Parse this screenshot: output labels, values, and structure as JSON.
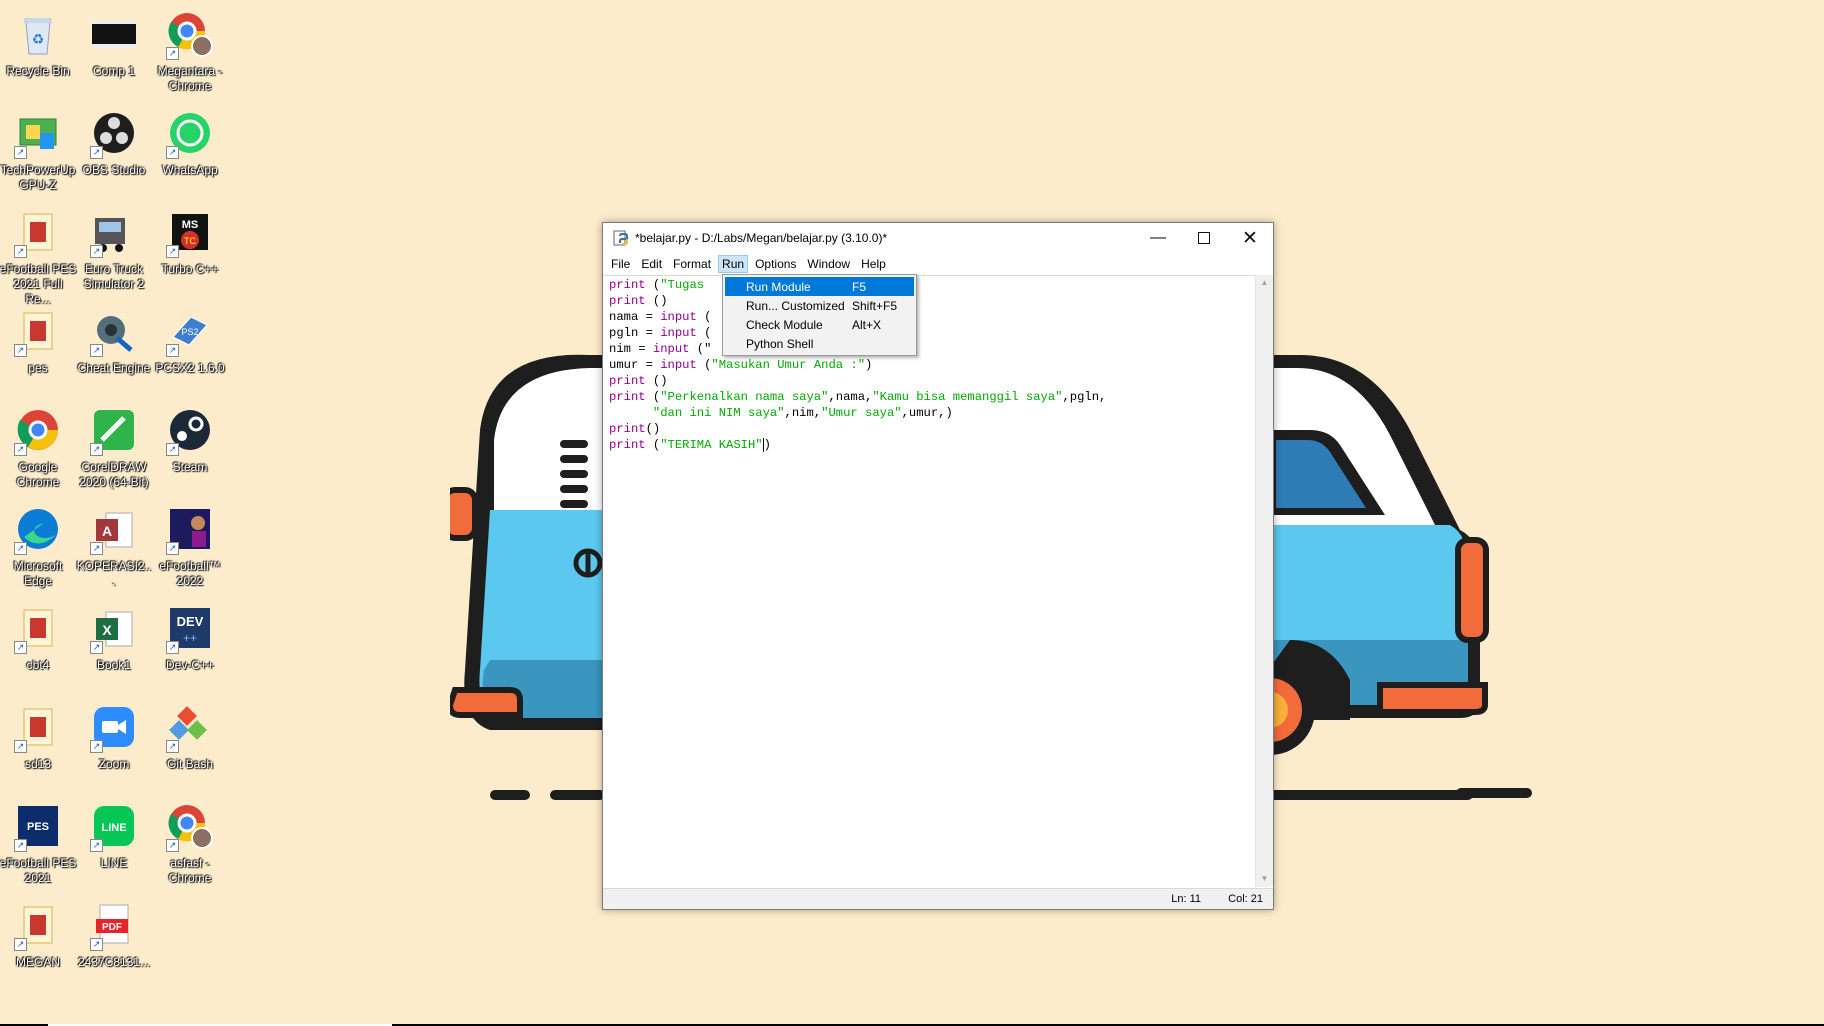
{
  "desktop": {
    "icons": [
      {
        "label": "Recycle Bin",
        "icon": "recycle-bin-icon"
      },
      {
        "label": "Comp 1",
        "icon": "video-file-icon"
      },
      {
        "label": "Megantara - Chrome",
        "icon": "chrome-profile-icon"
      },
      {
        "label": "TechPowerUp GPU-Z",
        "icon": "gpu-z-icon"
      },
      {
        "label": "OBS Studio",
        "icon": "obs-icon"
      },
      {
        "label": "WhatsApp",
        "icon": "whatsapp-icon"
      },
      {
        "label": "eFootball PES 2021 Full Re...",
        "icon": "folder-icon"
      },
      {
        "label": "Euro Truck Simulator 2",
        "icon": "truck-icon"
      },
      {
        "label": "Turbo C++",
        "icon": "turbo-cpp-icon"
      },
      {
        "label": "pes",
        "icon": "folder-icon"
      },
      {
        "label": "Cheat Engine",
        "icon": "cheat-engine-icon"
      },
      {
        "label": "PCSX2 1.6.0",
        "icon": "pcsx2-icon"
      },
      {
        "label": "Google Chrome",
        "icon": "chrome-icon"
      },
      {
        "label": "CorelDRAW 2020 (64-Bit)",
        "icon": "coreldraw-icon"
      },
      {
        "label": "Steam",
        "icon": "steam-icon"
      },
      {
        "label": "Microsoft Edge",
        "icon": "edge-icon"
      },
      {
        "label": "KOPERASI2...",
        "icon": "access-icon"
      },
      {
        "label": "eFootball™ 2022",
        "icon": "efootball-icon"
      },
      {
        "label": "cbt4",
        "icon": "folder-icon"
      },
      {
        "label": "Book1",
        "icon": "excel-icon"
      },
      {
        "label": "Dev-C++",
        "icon": "devcpp-icon"
      },
      {
        "label": "sd13",
        "icon": "folder-icon"
      },
      {
        "label": "Zoom",
        "icon": "zoom-icon"
      },
      {
        "label": "Git Bash",
        "icon": "git-bash-icon"
      },
      {
        "label": "eFootball PES 2021",
        "icon": "pes-icon"
      },
      {
        "label": "LINE",
        "icon": "line-icon"
      },
      {
        "label": "asfasf - Chrome",
        "icon": "chrome-profile-icon"
      },
      {
        "label": "MEGAN",
        "icon": "folder-icon"
      },
      {
        "label": "2437C8131...",
        "icon": "pdf-icon"
      }
    ]
  },
  "window": {
    "title": "*belajar.py - D:/Labs/Megan/belajar.py (3.10.0)*",
    "menus": [
      "File",
      "Edit",
      "Format",
      "Run",
      "Options",
      "Window",
      "Help"
    ],
    "active_menu": "Run"
  },
  "run_menu": {
    "items": [
      {
        "label": "Run Module",
        "accel": "F5",
        "highlighted": true
      },
      {
        "label": "Run... Customized",
        "accel": "Shift+F5",
        "highlighted": false
      },
      {
        "label": "Check Module",
        "accel": "Alt+X",
        "highlighted": false
      },
      {
        "label": "Python Shell",
        "accel": "",
        "highlighted": false
      }
    ]
  },
  "editor": {
    "lines": [
      [
        {
          "t": "print",
          "c": "kw"
        },
        {
          "t": " (",
          "c": "blk"
        },
        {
          "t": "\"Tugas ",
          "c": "str"
        }
      ],
      [
        {
          "t": "print",
          "c": "kw"
        },
        {
          "t": " ()",
          "c": "blk"
        }
      ],
      [
        {
          "t": "nama = ",
          "c": "blk"
        },
        {
          "t": "input",
          "c": "kw"
        },
        {
          "t": " (",
          "c": "blk"
        }
      ],
      [
        {
          "t": "pgln = ",
          "c": "blk"
        },
        {
          "t": "input",
          "c": "kw"
        },
        {
          "t": " (",
          "c": "blk"
        }
      ],
      [
        {
          "t": "nim = ",
          "c": "blk"
        },
        {
          "t": "input",
          "c": "kw"
        },
        {
          "t": " (\"",
          "c": "blk"
        }
      ],
      [
        {
          "t": "umur = ",
          "c": "blk"
        },
        {
          "t": "input",
          "c": "kw"
        },
        {
          "t": " (",
          "c": "blk"
        },
        {
          "t": "\"Masukan Umur Anda :\"",
          "c": "str"
        },
        {
          "t": ")",
          "c": "blk"
        }
      ],
      [
        {
          "t": "print",
          "c": "kw"
        },
        {
          "t": " ()",
          "c": "blk"
        }
      ],
      [
        {
          "t": "print",
          "c": "kw"
        },
        {
          "t": " (",
          "c": "blk"
        },
        {
          "t": "\"Perkenalkan nama saya\"",
          "c": "str"
        },
        {
          "t": ",nama,",
          "c": "blk"
        },
        {
          "t": "\"Kamu bisa memanggil saya\"",
          "c": "str"
        },
        {
          "t": ",pgln,",
          "c": "blk"
        }
      ],
      [
        {
          "t": "      ",
          "c": "blk"
        },
        {
          "t": "\"dan ini NIM saya\"",
          "c": "str"
        },
        {
          "t": ",nim,",
          "c": "blk"
        },
        {
          "t": "\"Umur saya\"",
          "c": "str"
        },
        {
          "t": ",umur,)",
          "c": "blk"
        }
      ],
      [
        {
          "t": "print",
          "c": "kw"
        },
        {
          "t": "()",
          "c": "blk"
        }
      ],
      [
        {
          "t": "print",
          "c": "kw"
        },
        {
          "t": " (",
          "c": "blk"
        },
        {
          "t": "\"TERIMA KASIH\"",
          "c": "str"
        },
        {
          "t": ")",
          "c": "blk"
        }
      ]
    ]
  },
  "status": {
    "ln": "Ln: 11",
    "col": "Col: 21"
  },
  "colors": {
    "desktop_bg": "#fdeccb",
    "keyword": "#900090",
    "string": "#00aa00",
    "menu_highlight": "#0078d7"
  }
}
